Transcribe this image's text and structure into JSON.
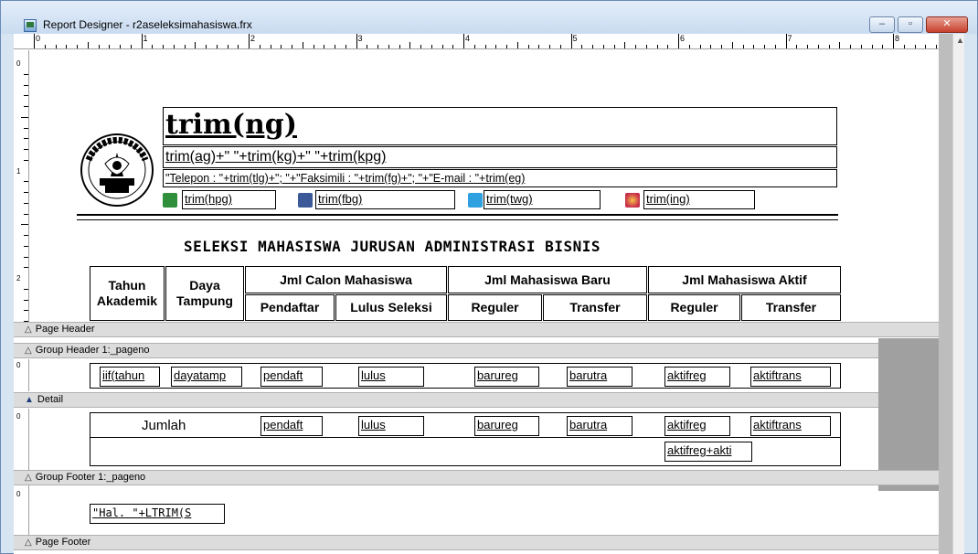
{
  "window": {
    "title": "Report Designer - r2aseleksimahasiswa.frx",
    "min_label": "–",
    "max_label": "▫",
    "close_label": "✕"
  },
  "ruler": {
    "h_numbers": [
      "0",
      "1",
      "2",
      "3",
      "4",
      "5",
      "6",
      "7",
      "8"
    ],
    "v_page_header_numbers": [
      "0",
      "1",
      "2"
    ],
    "v_band_zero": "0"
  },
  "bands": {
    "page_header": "Page Header",
    "group_header": "Group Header 1:_pageno",
    "detail": "Detail",
    "group_footer": "Group Footer 1:_pageno",
    "page_footer": "Page Footer"
  },
  "header": {
    "logo_text": "politeknik negeri semarang",
    "name_expr": "trim(ng)",
    "address_expr": "trim(ag)+\" \"+trim(kg)+\" \"+trim(kpg)",
    "contact_expr": "\"Telepon : \"+trim(tlg)+\"; \"+\"Faksimili : \"+trim(fg)+\"; \"+\"E-mail : \"+trim(eg)",
    "social": [
      {
        "icon": "phone-icon",
        "color": "#2f8f3a",
        "expr": "trim(hpg)"
      },
      {
        "icon": "facebook-icon",
        "color": "#3b5998",
        "expr": "trim(fbg)"
      },
      {
        "icon": "twitter-icon",
        "color": "#2fa0e0",
        "expr": "trim(twg)"
      },
      {
        "icon": "instagram-icon",
        "color": "#c8304a",
        "expr": "trim(ing)"
      }
    ],
    "report_title": "SELEKSI MAHASISWA JURUSAN ADMINISTRASI BISNIS"
  },
  "table_header": {
    "tahun_1": "Tahun",
    "tahun_2": "Akademik",
    "daya_1": "Daya",
    "daya_2": "Tampung",
    "jml_calon": "Jml Calon Mahasiswa",
    "jml_baru": "Jml Mahasiswa Baru",
    "jml_aktif": "Jml Mahasiswa Aktif",
    "pendaftar": "Pendaftar",
    "lulus_seleksi": "Lulus Seleksi",
    "reguler_1": "Reguler",
    "transfer_1": "Transfer",
    "reguler_2": "Reguler",
    "transfer_2": "Transfer"
  },
  "detail_fields": [
    "iif(tahun",
    "dayatamp",
    "pendaft",
    "lulus",
    "barureg",
    "barutra",
    "aktifreg",
    "aktiftrans"
  ],
  "footer_row": {
    "label": "Jumlah",
    "fields": [
      "pendaft",
      "lulus",
      "barureg",
      "barutra",
      "aktifreg",
      "aktiftrans"
    ],
    "total_expr": "aktifreg+akti"
  },
  "page_footer_expr": "\"Hal. \"+LTRIM(S"
}
